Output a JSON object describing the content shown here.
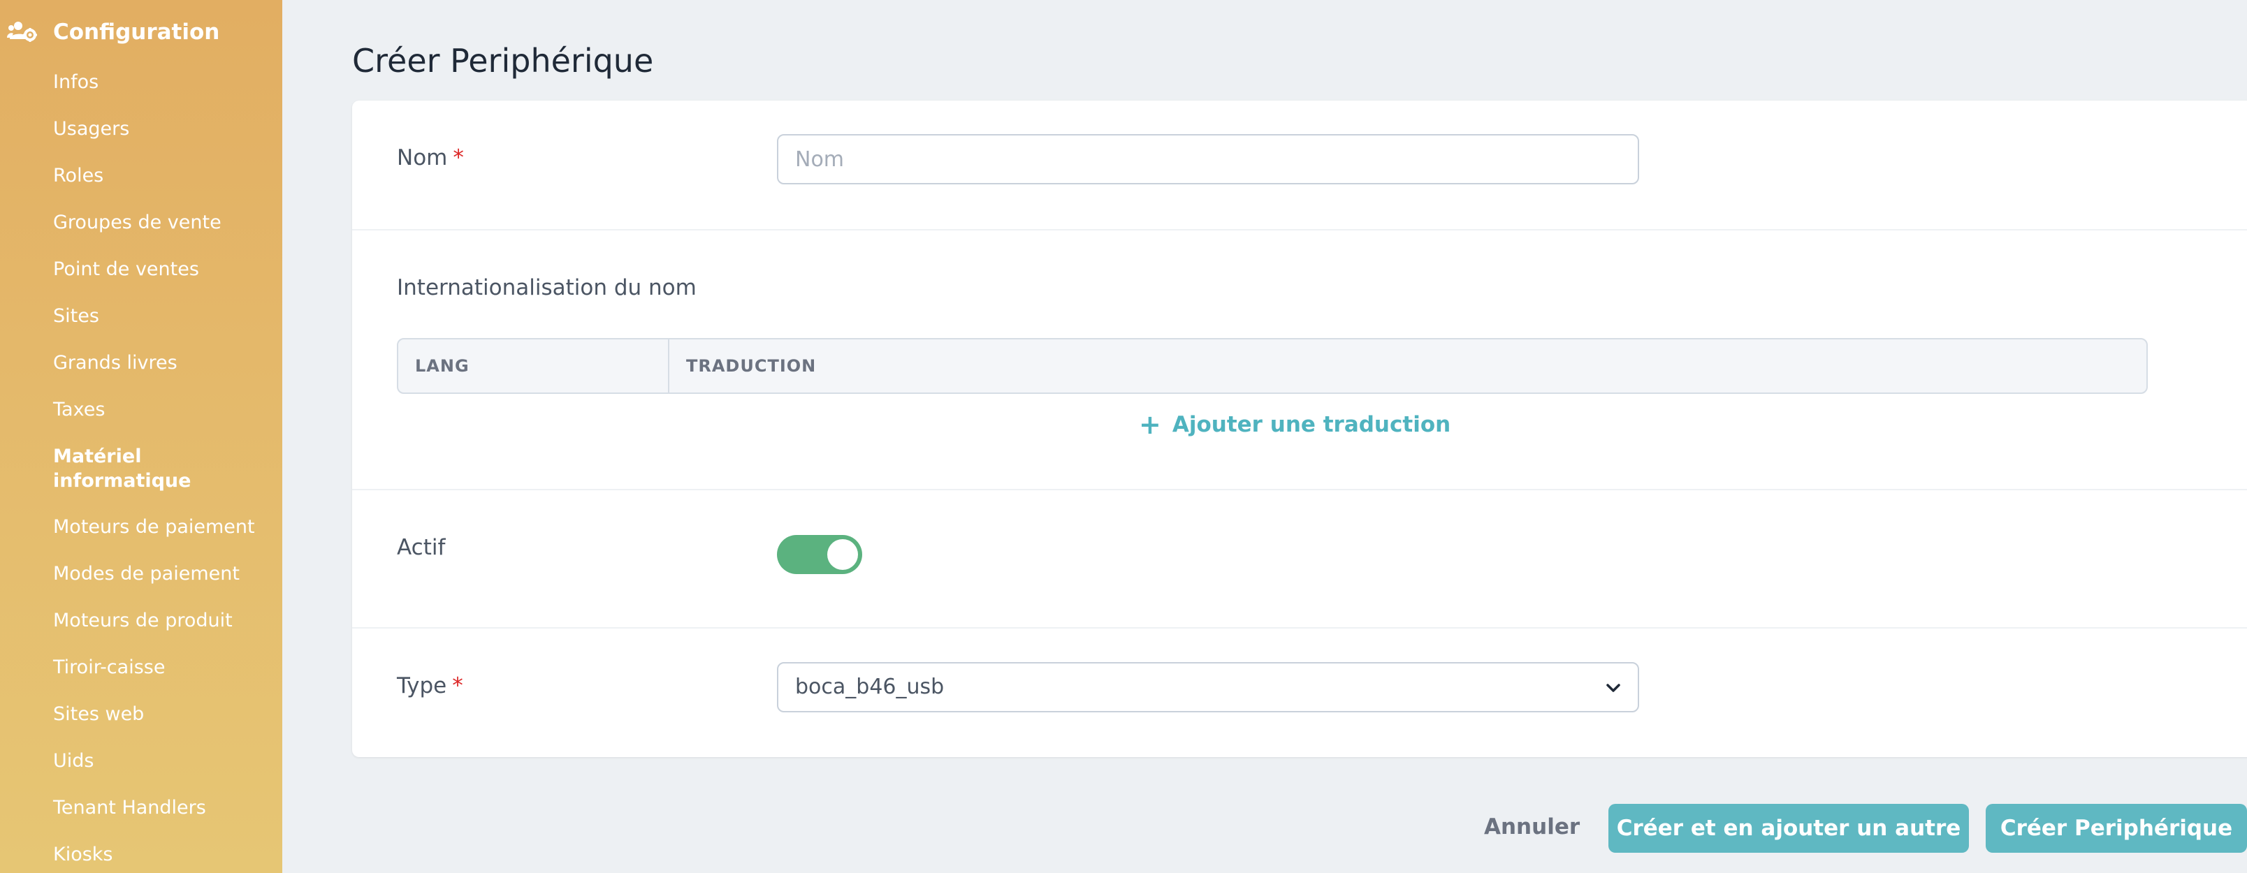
{
  "sidebar": {
    "title": "Configuration",
    "header_icon": "users-cog-icon",
    "items": [
      {
        "label": "Infos"
      },
      {
        "label": "Usagers"
      },
      {
        "label": "Roles"
      },
      {
        "label": "Groupes de vente"
      },
      {
        "label": "Point de ventes"
      },
      {
        "label": "Sites"
      },
      {
        "label": "Grands livres"
      },
      {
        "label": "Taxes"
      },
      {
        "label_line1": "Matériel",
        "label_line2": "informatique",
        "active": true
      },
      {
        "label": "Moteurs de paiement"
      },
      {
        "label": "Modes de paiement"
      },
      {
        "label": "Moteurs de produit"
      },
      {
        "label": "Tiroir-caisse"
      },
      {
        "label": "Sites web"
      },
      {
        "label": "Uids"
      },
      {
        "label": "Tenant Handlers"
      },
      {
        "label": "Kiosks"
      }
    ]
  },
  "page": {
    "title": "Créer Periphérique"
  },
  "form": {
    "name": {
      "label": "Nom",
      "required_mark": "*",
      "placeholder": "Nom",
      "value": ""
    },
    "i18n": {
      "label": "Internationalisation du nom",
      "columns": [
        "LANG",
        "TRADUCTION"
      ],
      "add_label": "Ajouter une traduction",
      "add_icon": "+"
    },
    "active": {
      "label": "Actif",
      "checked": true
    },
    "type": {
      "label": "Type",
      "required_mark": "*",
      "value": "boca_b46_usb"
    }
  },
  "actions": {
    "cancel": "Annuler",
    "create_and_another": "Créer et en ajouter un autre",
    "create": "Créer Periphérique"
  },
  "colors": {
    "sidebar": "#e2ae62",
    "accent": "#5fb8c2",
    "toggle_on": "#5bb27f",
    "required": "#dc2626"
  }
}
